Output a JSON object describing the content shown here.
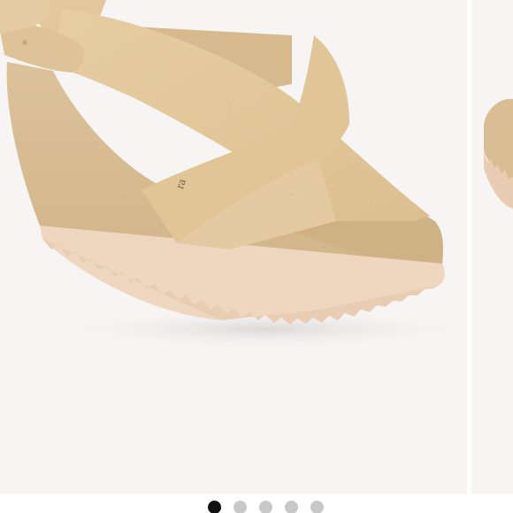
{
  "gallery": {
    "main_image": {
      "alt": "",
      "icon": "sandal-product-image"
    },
    "next_image": {
      "icon": "sandal-product-image-peek"
    },
    "pagination": {
      "active_index": 0,
      "dots": [
        {
          "state": "active"
        },
        {
          "state": "inactive"
        },
        {
          "state": "inactive"
        },
        {
          "state": "inactive"
        },
        {
          "state": "inactive"
        }
      ]
    }
  },
  "colors": {
    "background": "#f6f5f4",
    "suede": "#d8bd92",
    "leather": "#e3c99b",
    "sole": "#f0d8c0",
    "dot_active": "#111111",
    "dot_inactive": "#c8c8c8"
  }
}
